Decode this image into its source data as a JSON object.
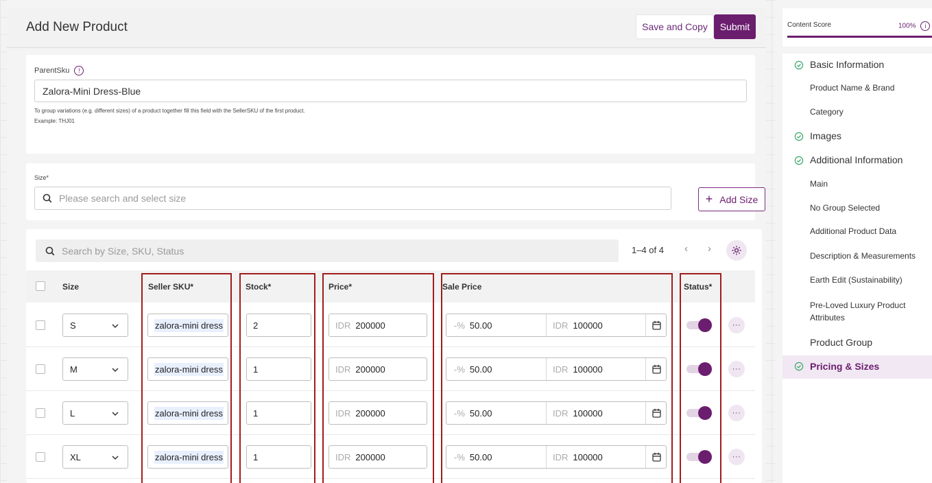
{
  "header": {
    "title": "Add New Product",
    "save_copy_label": "Save and Copy",
    "submit_label": "Submit"
  },
  "parent_sku": {
    "label": "ParentSku",
    "info_glyph": "!",
    "value": "Zalora-Mini Dress-Blue",
    "hint": "To group variations (e.g. different sizes) of a product together fill this field with the SellerSKU of the first product.",
    "example": "Example: THJ01"
  },
  "size_selector": {
    "label": "Size*",
    "placeholder": "Please search and select size",
    "add_label": "Add Size",
    "add_icon": "+"
  },
  "table": {
    "search_placeholder": "Search by Size, SKU, Status",
    "pagination": "1–4 of 4",
    "prev": "‹",
    "next": "›",
    "headers": {
      "size": "Size",
      "seller_sku": "Seller SKU*",
      "stock": "Stock*",
      "price": "Price*",
      "sale_price": "Sale Price",
      "status": "Status*"
    },
    "currency": "IDR",
    "discount_prefix": "-%",
    "more_glyph": "···",
    "rows": [
      {
        "size": "S",
        "sku": "zalora-mini dress",
        "stock": "2",
        "price": "200000",
        "discount": "50.00",
        "sale_price": "100000",
        "status": true
      },
      {
        "size": "M",
        "sku": "zalora-mini dress",
        "stock": "1",
        "price": "200000",
        "discount": "50.00",
        "sale_price": "100000",
        "status": true
      },
      {
        "size": "L",
        "sku": "zalora-mini dress",
        "stock": "1",
        "price": "200000",
        "discount": "50.00",
        "sale_price": "100000",
        "status": true
      },
      {
        "size": "XL",
        "sku": "zalora-mini dress",
        "stock": "1",
        "price": "200000",
        "discount": "50.00",
        "sale_price": "100000",
        "status": true
      }
    ]
  },
  "sidebar": {
    "content_score_label": "Content Score",
    "content_score_value": "100%",
    "items": [
      {
        "label": "Basic Information",
        "section": true,
        "checked": true
      },
      {
        "label": "Product Name & Brand",
        "section": false,
        "checked": false
      },
      {
        "label": "Category",
        "section": false,
        "checked": false
      },
      {
        "label": "Images",
        "section": true,
        "checked": true
      },
      {
        "label": "Additional Information",
        "section": true,
        "checked": true
      },
      {
        "label": "Main",
        "section": false,
        "checked": false
      },
      {
        "label": "No Group Selected",
        "section": false,
        "checked": false
      },
      {
        "label": "Additional Product Data",
        "section": false,
        "checked": false
      },
      {
        "label": "Description & Measurements",
        "section": false,
        "checked": false
      },
      {
        "label": "Earth Edit (Sustainability)",
        "section": false,
        "checked": false
      },
      {
        "label": "Pre-Loved Luxury Product Attributes",
        "section": false,
        "checked": false
      },
      {
        "label": "Product Group",
        "section": true,
        "checked": false
      },
      {
        "label": "Pricing & Sizes",
        "section": true,
        "checked": true,
        "active": true
      }
    ]
  },
  "colors": {
    "brand": "#6b1d6e",
    "highlight": "#a01c1c",
    "check": "#3aa86b"
  },
  "icons": [
    "info-icon",
    "search-icon",
    "plus-icon",
    "chevron-left-icon",
    "chevron-right-icon",
    "gear-icon",
    "chevron-down-icon",
    "calendar-icon",
    "more-icon",
    "check-circle-icon"
  ]
}
